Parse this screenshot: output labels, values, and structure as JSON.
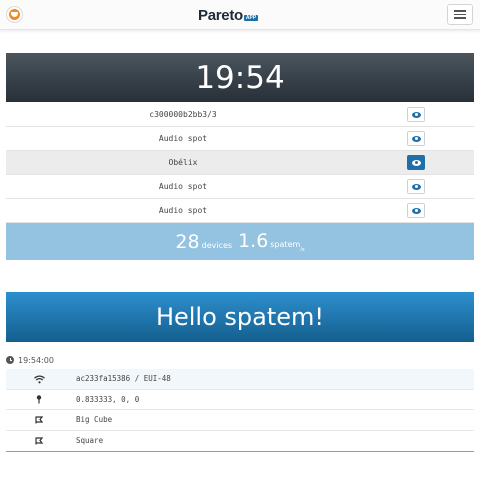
{
  "navbar": {
    "brand": "Pareto",
    "brand_tag": "APP"
  },
  "clock": {
    "time": "19:54"
  },
  "devices": [
    {
      "label": "c300000b2bb3/3",
      "active": false
    },
    {
      "label": "Audio spot",
      "active": false
    },
    {
      "label": "Obélix",
      "active": true
    },
    {
      "label": "Audio spot",
      "active": false
    },
    {
      "label": "Audio spot",
      "active": false
    }
  ],
  "stats": {
    "devices_count": "28",
    "devices_label": "devices",
    "spatem_value": "1.6",
    "spatem_label": "spatem",
    "spatem_sub": "/s"
  },
  "hello": {
    "text": "Hello spatem!"
  },
  "timestamp": "19:54:00",
  "details": [
    {
      "icon": "wifi-icon",
      "text": "ac233fa15386 / EUI-48"
    },
    {
      "icon": "pin-icon",
      "text": "0.833333, 0, 0"
    },
    {
      "icon": "location-flag-icon",
      "text": "Big Cube"
    },
    {
      "icon": "location-flag-icon",
      "text": "Square"
    }
  ],
  "colors": {
    "accent": "#1e6fa8",
    "clock_bg": "#283038",
    "stats_bg": "#93c3e0",
    "hello_bg": "#1f78b4"
  }
}
